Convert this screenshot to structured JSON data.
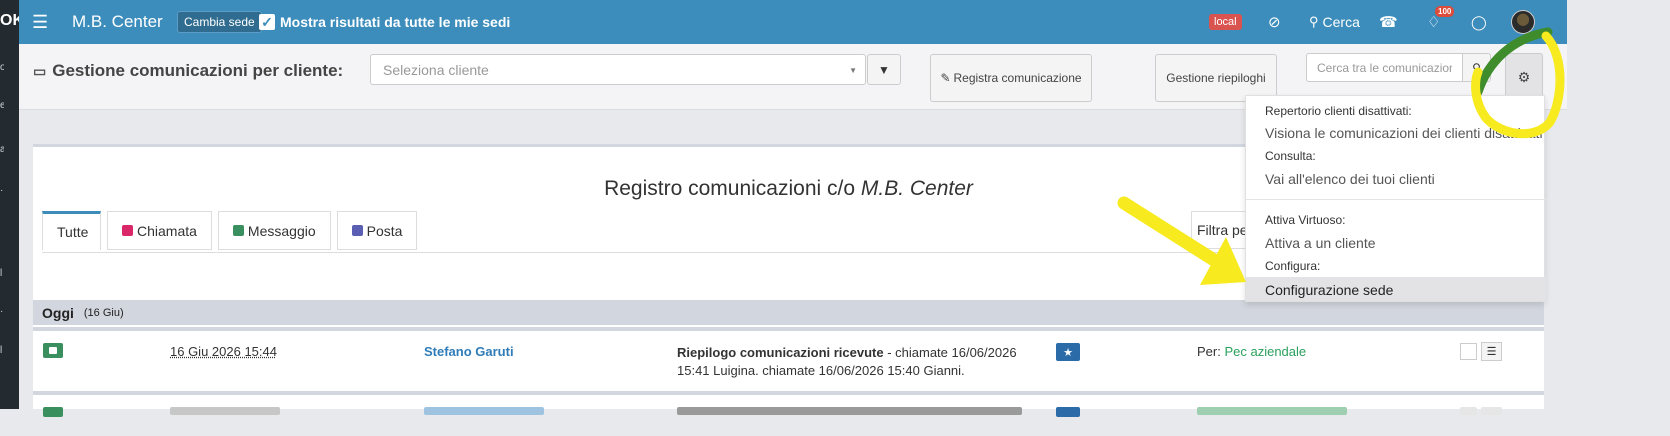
{
  "sidebar": {
    "logo": "OK"
  },
  "navbar": {
    "brand": "M.B. Center",
    "change_site": "Cambia sede",
    "show_all": "Mostra risultati da tutte le mie sedi",
    "env_badge": "local",
    "search_label": "Cerca",
    "notifications_count": "100"
  },
  "header": {
    "title": "Gestione comunicazioni per cliente:",
    "client_placeholder": "Seleziona cliente",
    "register_button": "Registra comunicazione",
    "summaries_button": "Gestione riepiloghi",
    "search_placeholder": "Cerca tra le comunicazioni"
  },
  "dropdown": {
    "s1_header": "Repertorio clienti disattivati:",
    "s1_item": "Visiona le comunicazioni dei clienti disattivati",
    "s2_header": "Consulta:",
    "s2_item": "Vai all'elenco dei tuoi clienti",
    "s3_header": "Attiva Virtuoso:",
    "s3_item": "Attiva a un cliente",
    "s4_header": "Configura:",
    "s4_item": "Configurazione sede"
  },
  "main": {
    "title_prefix": "Registro comunicazioni c/o",
    "title_site": "M.B. Center",
    "tabs": [
      "Tutte",
      "Chiamata",
      "Messaggio",
      "Posta"
    ],
    "filter_label": "Filtra pe",
    "day_label": "Oggi",
    "day_date": "(16 Giu)",
    "row": {
      "date": "16 Giu 2026 15:44",
      "client": "Stefano Garuti",
      "subject": "Riepilogo comunicazioni ricevute",
      "body": " - chiamate 16/06/2026 15:41 Luigina. chiamate 16/06/2026 15:40 Gianni.",
      "per_label": "Per:",
      "per_value": "Pec aziendale"
    }
  },
  "colors": {
    "navbar": "#3c8dbc",
    "annotation": "#f7ea1e",
    "annotation_green": "#3f8c2d",
    "call_icon": "#d9276a",
    "message_icon": "#3a8f5f",
    "mail_icon": "#5b5fb3"
  }
}
